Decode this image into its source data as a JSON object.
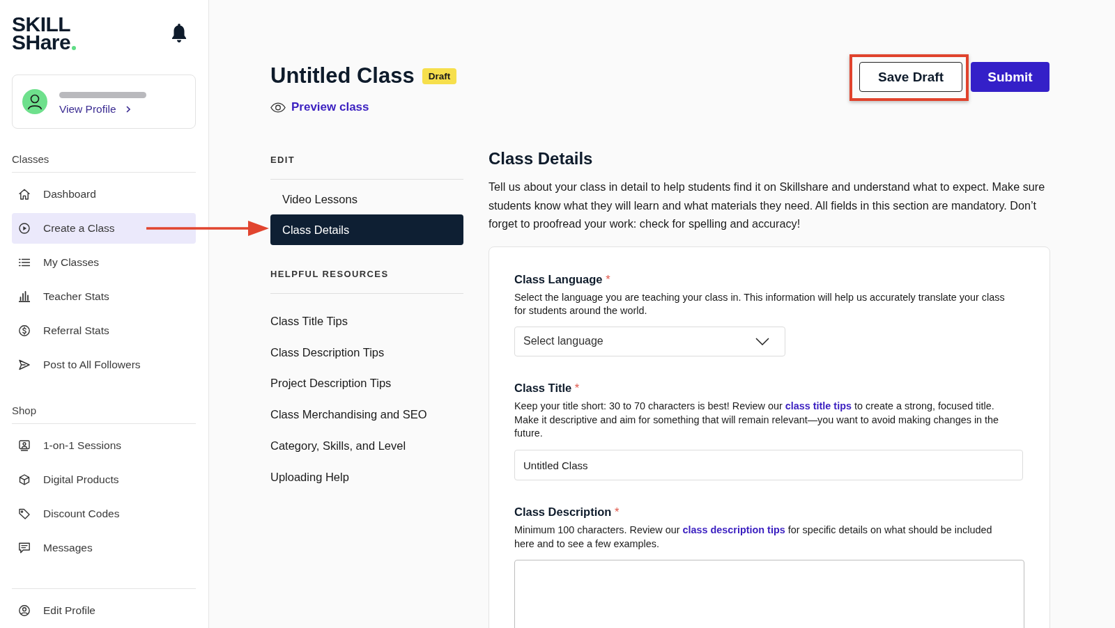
{
  "sidebar": {
    "logo": {
      "lines": [
        "SKILL",
        "SHare"
      ]
    },
    "profile": {
      "link": "View Profile"
    },
    "sections": [
      {
        "heading": "Classes",
        "items": [
          {
            "label": "Dashboard",
            "selected": false
          },
          {
            "label": "Create a Class",
            "selected": true
          },
          {
            "label": "My Classes",
            "selected": false
          },
          {
            "label": "Teacher Stats",
            "selected": false
          },
          {
            "label": "Referral Stats",
            "selected": false
          },
          {
            "label": "Post to All Followers",
            "selected": false
          }
        ]
      },
      {
        "heading": "Shop",
        "items": [
          {
            "label": "1-on-1 Sessions",
            "selected": false
          },
          {
            "label": "Digital Products",
            "selected": false
          },
          {
            "label": "Discount Codes",
            "selected": false
          },
          {
            "label": "Messages",
            "selected": false
          }
        ]
      }
    ],
    "footer_items": [
      {
        "label": "Edit Profile",
        "selected": false
      }
    ]
  },
  "header": {
    "title": "Untitled Class",
    "badge": "Draft",
    "preview_link": "Preview class",
    "buttons": [
      {
        "label": "Save Draft",
        "kind": "outline",
        "highlighted": true
      },
      {
        "label": "Submit",
        "kind": "primary",
        "highlighted": false
      }
    ]
  },
  "edit_nav": {
    "heading": "EDIT",
    "items": [
      {
        "label": "Video Lessons",
        "selected": false
      },
      {
        "label": "Class Details",
        "selected": true
      }
    ]
  },
  "resources": {
    "heading": "HELPFUL RESOURCES",
    "links": [
      "Class Title Tips",
      "Class Description Tips",
      "Project Description Tips",
      "Class Merchandising and SEO",
      "Category, Skills, and Level",
      "Uploading Help"
    ]
  },
  "details": {
    "title": "Class Details",
    "intro": "Tell us about your class in detail to help students find it on Skillshare and understand what to expect. Make sure students know what they will learn and what materials they need. All fields in this section are mandatory. Don’t forget to proofread your work: check for spelling and accuracy!",
    "fields": [
      {
        "kind": "select",
        "label": "Class Language",
        "required_mark": "*",
        "description": [
          {
            "kind": "text",
            "text": "Select the language you are teaching your class in. This information will help us accurately translate your class for students around the world."
          }
        ],
        "placeholder": "Select language"
      },
      {
        "kind": "input",
        "label": "Class Title",
        "required_mark": "*",
        "description": [
          {
            "kind": "text",
            "text": "Keep your title short: 30 to 70 characters is best! Review our "
          },
          {
            "kind": "link",
            "text": "class title tips"
          },
          {
            "kind": "text",
            "text": " to create a strong, focused title. Make it descriptive and aim for something that will remain relevant—you want to avoid making changes in the future."
          }
        ],
        "value": "Untitled Class"
      },
      {
        "kind": "textarea",
        "label": "Class Description",
        "required_mark": "*",
        "description": [
          {
            "kind": "text",
            "text": "Minimum 100 characters. Review our "
          },
          {
            "kind": "link",
            "text": "class description tips"
          },
          {
            "kind": "text",
            "text": " for specific details on what should be included here and to see a few examples."
          }
        ]
      }
    ]
  },
  "callout_arrow": true
}
